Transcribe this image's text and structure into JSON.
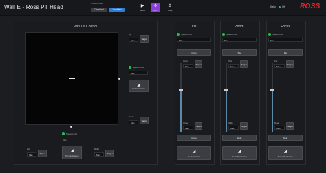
{
  "app": {
    "title": "Wall E - Ross PT Head"
  },
  "mode": {
    "label": "Control Mode",
    "options": [
      "Disabled",
      "Enabled"
    ],
    "selected": "Enabled"
  },
  "toolbar": [
    {
      "icon": "record-icon",
      "glyph": "▶",
      "label": "Record"
    },
    {
      "icon": "crosshair-icon",
      "glyph": "✥",
      "label": "Move"
    },
    {
      "icon": "gear-icon",
      "glyph": "⚙",
      "label": "Setup"
    }
  ],
  "status": {
    "label": "Status",
    "value": "OK"
  },
  "brand": {
    "logo": "ROSS"
  },
  "colors": {
    "accent": "#2f7bd3",
    "active_tool": "#8b3fd9",
    "ok": "#22c24a",
    "brand": "#e8262c"
  },
  "pantilt": {
    "title": "Pan/Tilt Control",
    "tilt_up": {
      "label": "Up",
      "value": "Max",
      "button": "Target"
    },
    "tilt_mid": {
      "label": "Speed Limit",
      "value": "Max",
      "button": "No Destination"
    },
    "tilt_down": {
      "label": "Down",
      "value": "Max",
      "button": "Target"
    },
    "speed": {
      "label": "Speed Limit",
      "value": "Max"
    },
    "left": {
      "label": "Left",
      "value": "Max",
      "button": "Target"
    },
    "pan_center": {
      "button": "Pan Destination"
    },
    "right": {
      "label": "Right",
      "value": "Max",
      "button": "Target"
    }
  },
  "columns": [
    {
      "title": "Iris",
      "speed_label": "Speed Limit",
      "speed_value": "Max",
      "main_button": "Open",
      "upper_label": "Open",
      "upper_value": "Max",
      "upper_button": "Target",
      "lower_label": "Close",
      "lower_value": "Max",
      "lower_button": "Target",
      "bottom_button": "Close",
      "dest_button": "No Destination",
      "fill": 0.62
    },
    {
      "title": "Zoom",
      "speed_label": "Speed Limit",
      "speed_value": "Max",
      "main_button": "Tele",
      "upper_label": "Tele",
      "upper_value": "Max",
      "upper_button": "Target",
      "lower_label": "Wide",
      "lower_value": "Max",
      "lower_button": "Target",
      "bottom_button": "Wide",
      "dest_button": "Zoom Destination",
      "fill": 0.62
    },
    {
      "title": "Focus",
      "speed_label": "Speed Limit",
      "speed_value": "Max",
      "main_button": "Far",
      "upper_label": "Far",
      "upper_value": "Max",
      "upper_button": "Target",
      "lower_label": "Near",
      "lower_value": "Max",
      "lower_button": "Target",
      "bottom_button": "Near",
      "dest_button": "Focus Destination",
      "fill": 0.62
    }
  ]
}
